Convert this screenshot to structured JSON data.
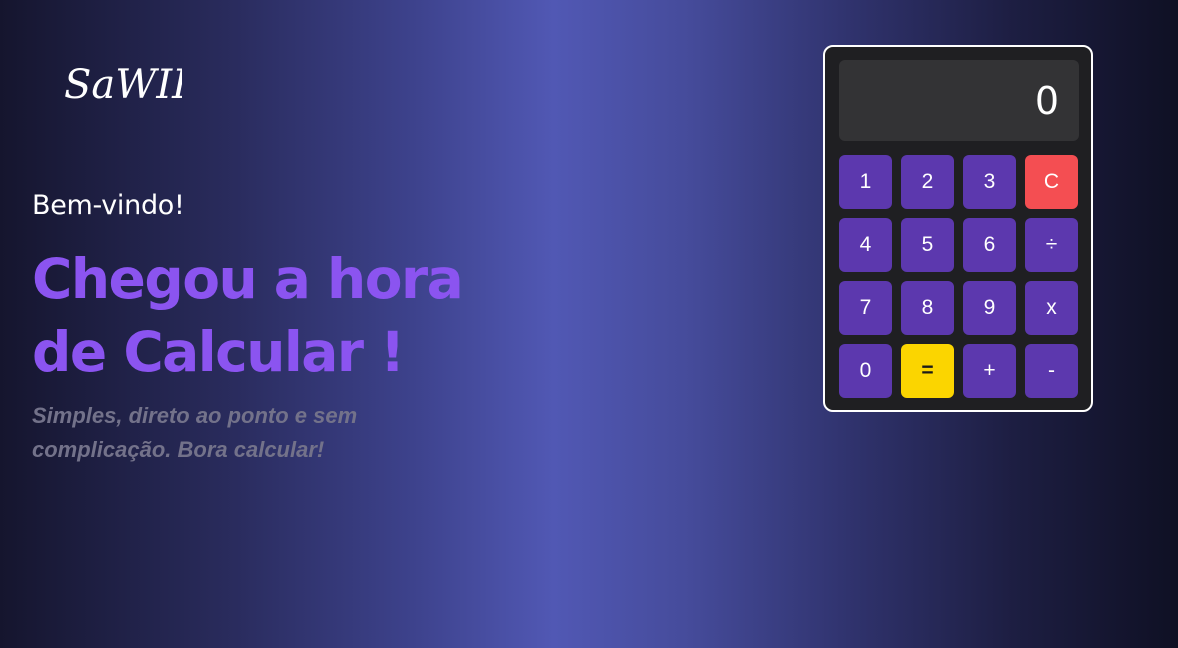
{
  "logo": {
    "text": "SaWIR"
  },
  "hero": {
    "welcome": "Bem-vindo!",
    "headline_line1": "Chegou a hora",
    "headline_line2": "de Calcular !",
    "subtitle": "Simples, direto ao ponto e sem complicação. Bora calcular!"
  },
  "calculator": {
    "display": "0",
    "keys": {
      "k1": "1",
      "k2": "2",
      "k3": "3",
      "clear": "C",
      "k4": "4",
      "k5": "5",
      "k6": "6",
      "divide": "÷",
      "k7": "7",
      "k8": "8",
      "k9": "9",
      "multiply": "x",
      "k0": "0",
      "equals": "=",
      "plus": "+",
      "minus": "-"
    }
  },
  "colors": {
    "accent": "#8b54f0",
    "key": "#5c38ae",
    "clear": "#f44e52",
    "equals": "#fbd500",
    "display_bg": "#333335",
    "calculator_bg": "#1f1f22"
  }
}
